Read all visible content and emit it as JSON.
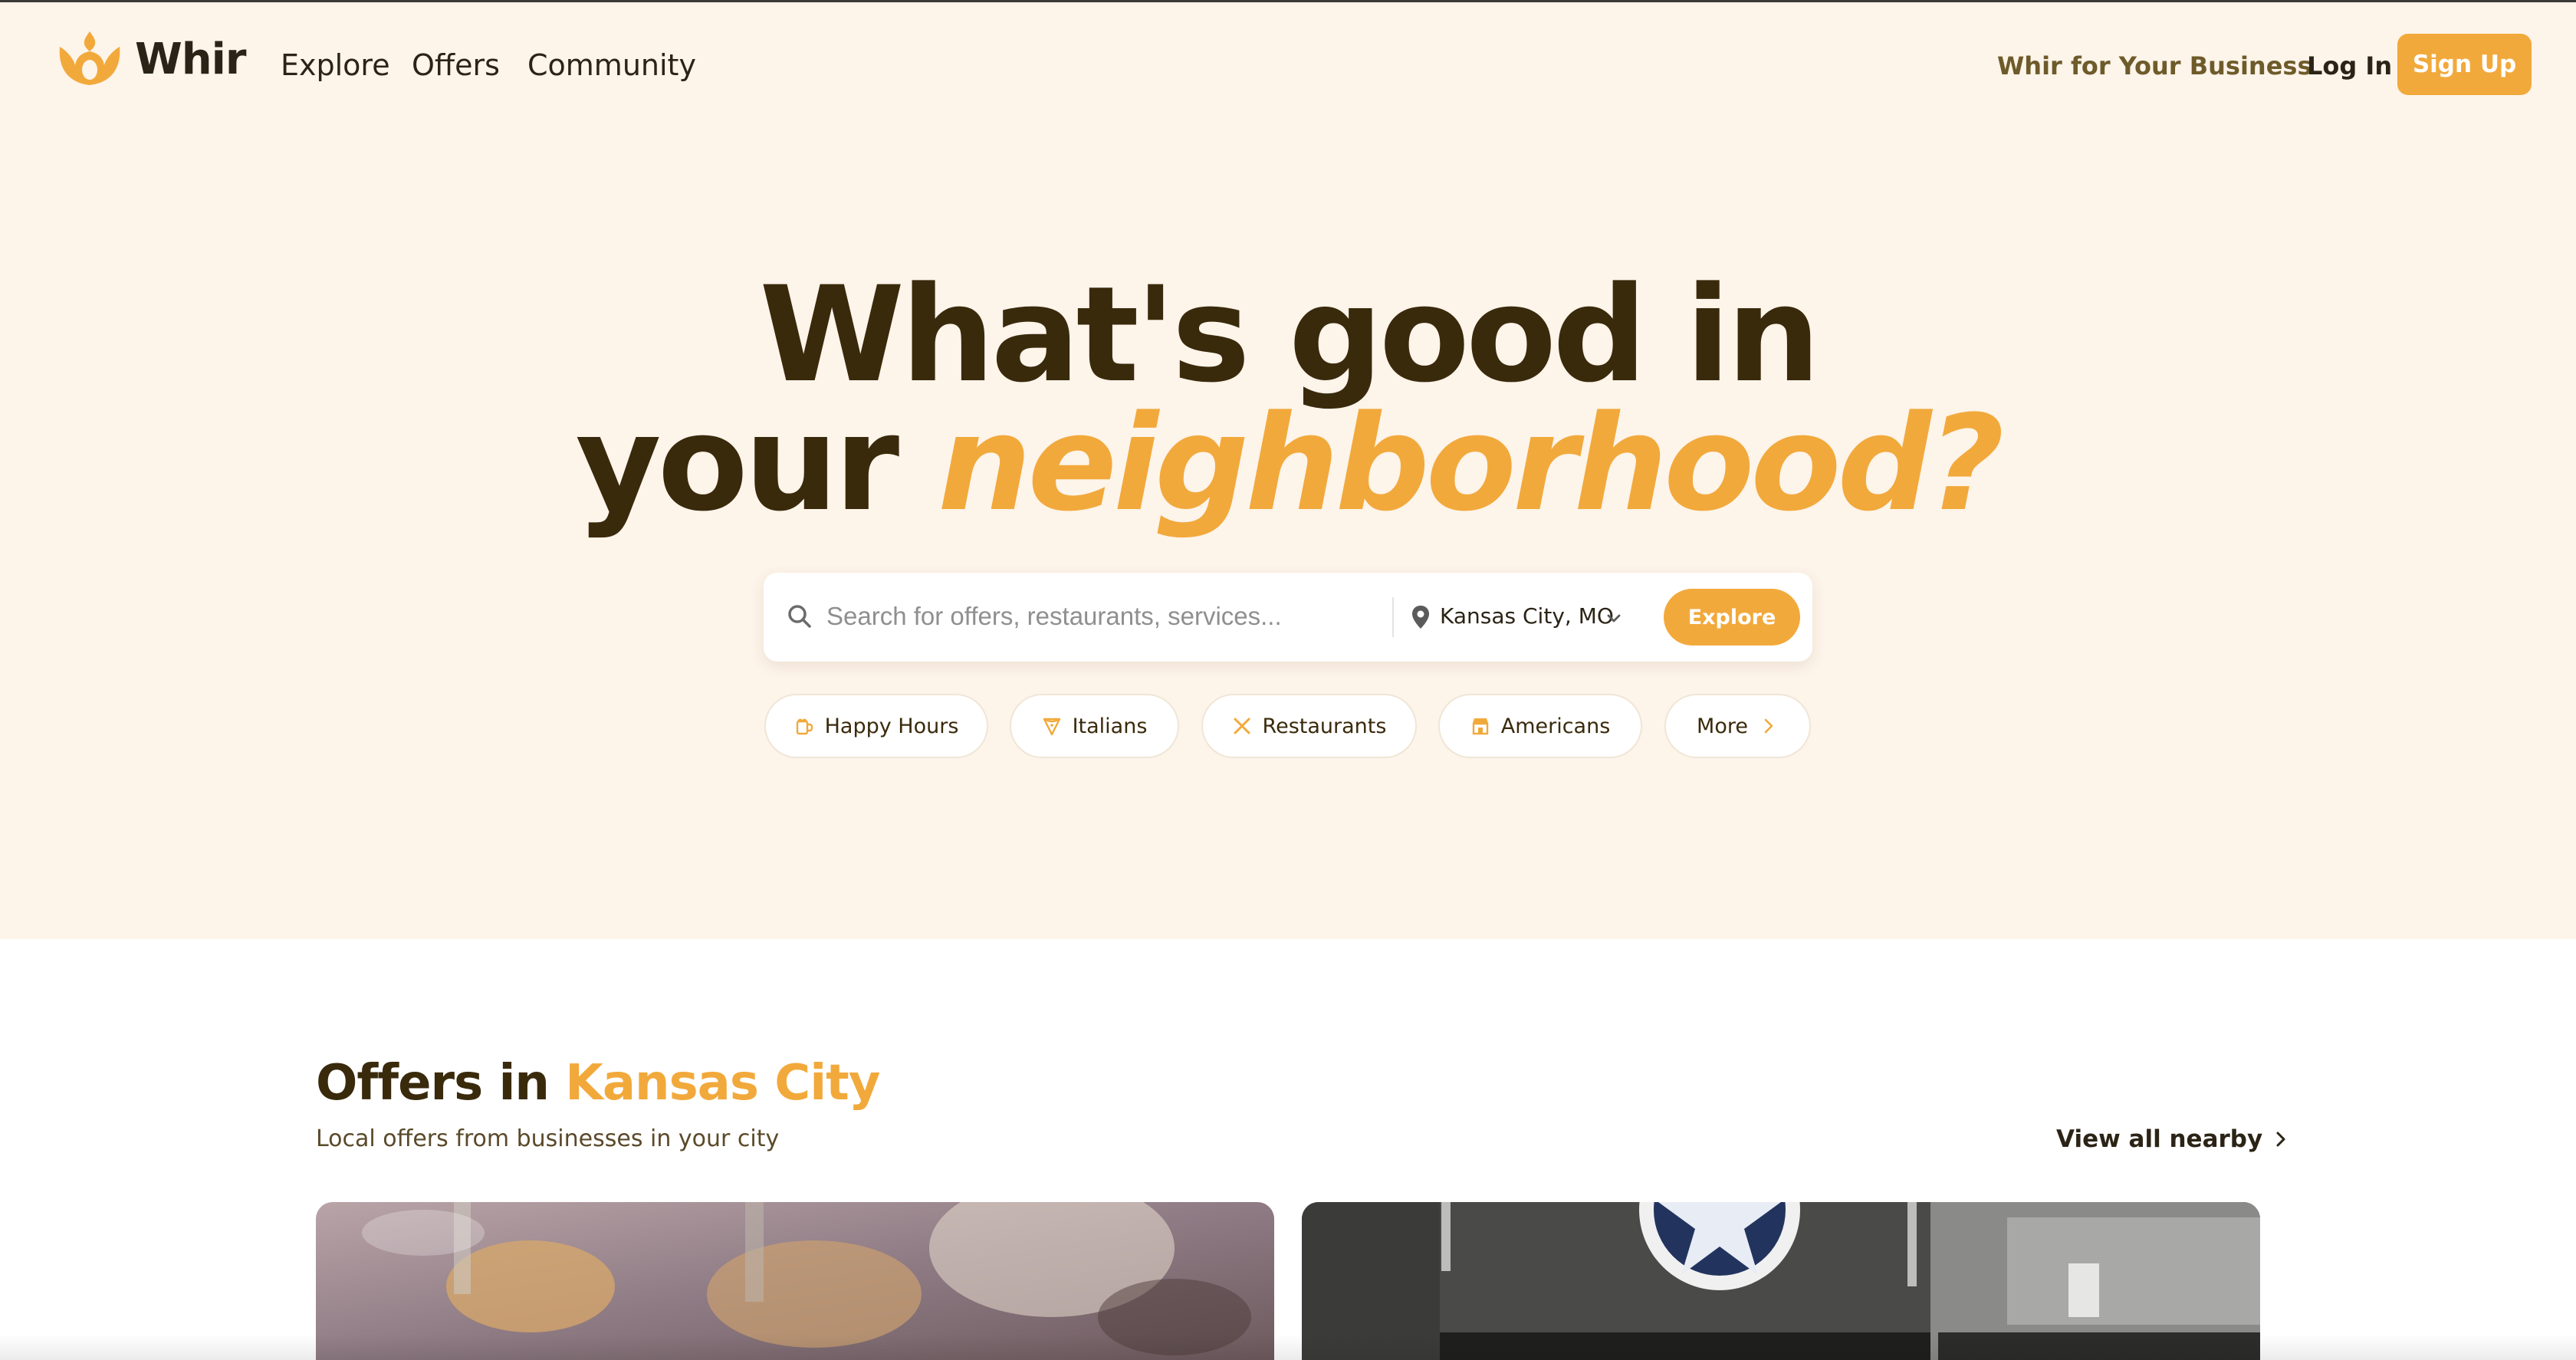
{
  "nav": {
    "brand": "Whir",
    "links": [
      "Explore",
      "Offers",
      "Community"
    ],
    "business_link": "Whir for Your Business",
    "login": "Log In",
    "signup": "Sign Up"
  },
  "hero": {
    "headline_line1": "What's good in",
    "headline_line2_plain": "your",
    "headline_line2_accent": "neighborhood?",
    "search": {
      "placeholder": "Search for offers, restaurants, services...",
      "location": "Kansas City, MO",
      "button": "Explore"
    },
    "chips": [
      {
        "label": "Happy Hours",
        "icon": "beer-mug-icon"
      },
      {
        "label": "Italians",
        "icon": "pizza-slice-icon"
      },
      {
        "label": "Restaurants",
        "icon": "utensils-icon"
      },
      {
        "label": "Americans",
        "icon": "storefront-icon"
      },
      {
        "label": "More",
        "icon": "chevron-right-icon"
      }
    ]
  },
  "offers": {
    "title_plain": "Offers in",
    "title_accent": "Kansas City",
    "subtitle": "Local offers from businesses in your city",
    "view_all": "View all nearby"
  },
  "colors": {
    "accent": "#f2a93b",
    "hero_bg": "#fdf4ea",
    "heading": "#3a2a0c"
  }
}
